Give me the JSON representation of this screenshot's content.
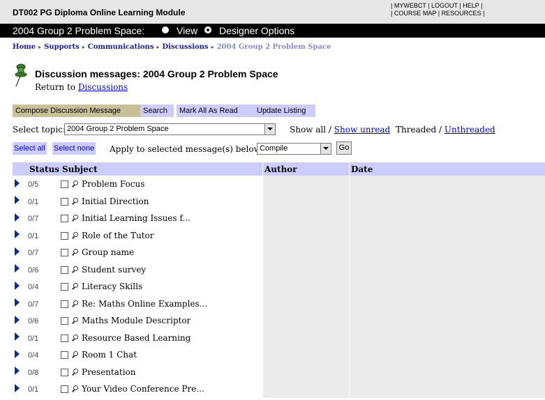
{
  "course": {
    "title": "DT002 PG Diploma Online Learning Module",
    "links_row1": [
      "MYWEBCT",
      "LOGOUT",
      "HELP"
    ],
    "links_row2": [
      "COURSE MAP",
      "RESOURCES"
    ]
  },
  "banner": {
    "space_title": "2004 Group 2 Problem Space:",
    "view_label": "View",
    "designer_label": "Designer Options",
    "selected": "Designer Options"
  },
  "breadcrumb": {
    "items": [
      "Home",
      "Supports",
      "Communications",
      "Discussions"
    ],
    "current": "2004 Group 2 Problem Space"
  },
  "page": {
    "title": "Discussion messages: 2004 Group 2 Problem Space",
    "return_prefix": "Return to",
    "return_link": "Discussions"
  },
  "toolbar": {
    "compose": "Compose Discussion Message",
    "search": "Search",
    "mark_all": "Mark All As Read",
    "update": "Update Listing"
  },
  "topic": {
    "label": "Select topic:",
    "value": "2004 Group 2 Problem Space",
    "show_all": "Show all",
    "show_unread": "Show unread",
    "threaded": "Threaded",
    "unthreaded": "Unthreaded"
  },
  "actions": {
    "select_all": "Select all",
    "select_none": "Select none",
    "apply_label": "Apply to selected message(s) below",
    "apply_value": "Compile",
    "go": "Go"
  },
  "table": {
    "headers": [
      "Status",
      "Subject",
      "Author",
      "Date"
    ],
    "rows": [
      {
        "status": "0/5",
        "subject": "Problem Focus"
      },
      {
        "status": "0/1",
        "subject": "Initial Direction"
      },
      {
        "status": "0/7",
        "subject": "Initial Learning Issues f..."
      },
      {
        "status": "0/1",
        "subject": "Role of the Tutor"
      },
      {
        "status": "0/7",
        "subject": "Group name"
      },
      {
        "status": "0/6",
        "subject": "Student survey"
      },
      {
        "status": "0/4",
        "subject": "Literacy Skills"
      },
      {
        "status": "0/7",
        "subject": "Re: Maths Online Examples..."
      },
      {
        "status": "0/6",
        "subject": "Maths Module Descriptor"
      },
      {
        "status": "0/1",
        "subject": "Resource Based Learning"
      },
      {
        "status": "0/4",
        "subject": "Room 1 Chat"
      },
      {
        "status": "0/8",
        "subject": "Presentation"
      },
      {
        "status": "0/1",
        "subject": "Your Video Conference Pre..."
      }
    ]
  },
  "colors": {
    "header_band": "#ccccff",
    "compose_button": "#c8c098",
    "link": "#0000cc",
    "row_shade": "#ebebeb"
  }
}
